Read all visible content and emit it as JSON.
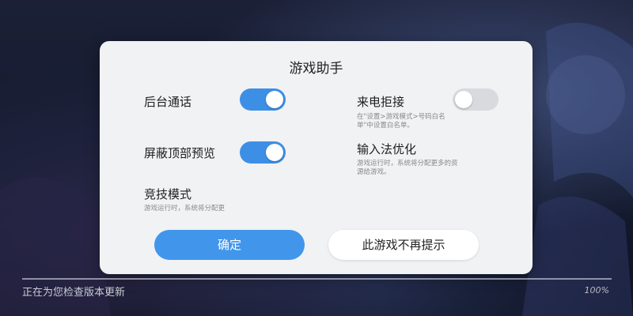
{
  "dialog": {
    "title": "游戏助手",
    "options": [
      {
        "label": "后台通话",
        "description": "",
        "toggle_state": "on"
      },
      {
        "label": "来电拒接",
        "description": "在\"设置>游戏模式>号码白名单\"中设置白名单。",
        "toggle_state": "off"
      },
      {
        "label": "屏蔽顶部预览",
        "description": "",
        "toggle_state": "on"
      },
      {
        "label": "输入法优化",
        "description": "游戏运行时，系统将分配更多的资源给游戏。",
        "toggle_state": "none"
      },
      {
        "label": "竞技模式",
        "description": "游戏运行时，系统将分配更",
        "toggle_state": "none"
      }
    ],
    "confirm_label": "确定",
    "dont_remind_label": "此游戏不再提示"
  },
  "status": {
    "message": "正在为您检查版本更新",
    "percent_label": "100%",
    "progress": 1.0
  },
  "colors": {
    "toggle_on": "#3d8fe6",
    "toggle_off": "#d9dadd",
    "primary_button": "#4196ec",
    "dialog_bg": "#f1f2f4"
  }
}
